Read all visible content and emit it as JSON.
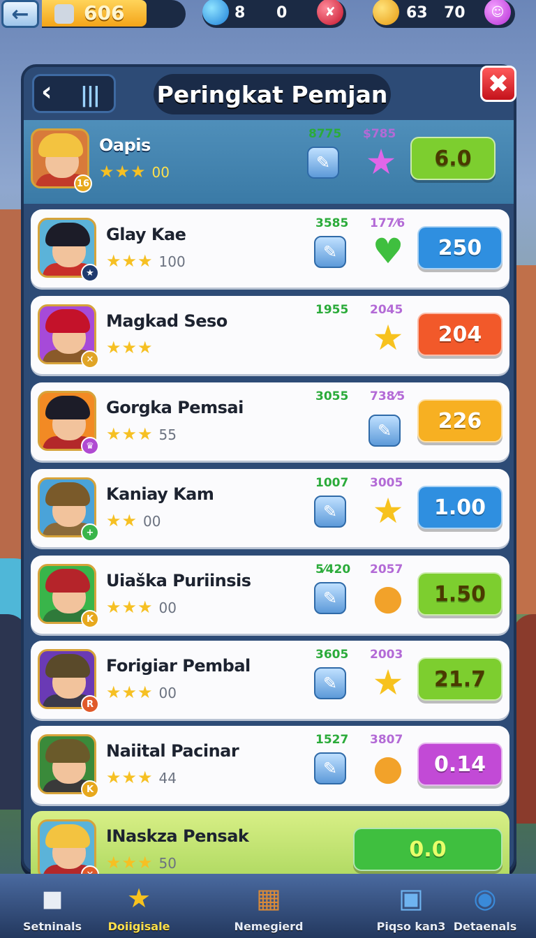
{
  "hud": {
    "coins": "606",
    "gems_a": "8",
    "gems_b": "0",
    "gold_a": "63",
    "gold_b": "70"
  },
  "panel": {
    "title": "Peringkat Pemjan"
  },
  "players": [
    {
      "name": "Oapis",
      "stars": "★★★",
      "points": "00",
      "stat1": "8775",
      "stat2": "$785",
      "score": "6.0",
      "icon1": "edit-icon",
      "icon2": "star-icon",
      "score_color": "#7dce2f",
      "score_text": "#4a3a00",
      "hair": "#f3c340",
      "body": "#c23a2a",
      "badge_color": "#e7a81d",
      "badge": "16",
      "avatar_bg": "#d87a3a"
    },
    {
      "name": "Glay Kae",
      "stars": "★★★",
      "points": "100",
      "stat1": "3585",
      "stat2": "177⁄6",
      "score": "250",
      "icon1": "edit-icon",
      "icon2": "heart-icon",
      "score_color": "#2f8fe0",
      "score_text": "#ffffff",
      "hair": "#1c1c28",
      "body": "#c8302a",
      "badge_color": "#1f3a6e",
      "badge": "★",
      "avatar_bg": "#5bb3d9"
    },
    {
      "name": "Magkad Seso",
      "stars": "★★★",
      "points": "",
      "stat1": "1955",
      "stat2": "2045",
      "score": "204",
      "icon1": "",
      "icon2": "star-icon",
      "score_color": "#f2592a",
      "score_text": "#ffffff",
      "hair": "#c4122a",
      "body": "#8a5a2a",
      "badge_color": "#e0a425",
      "badge": "✕",
      "avatar_bg": "#a64ad9"
    },
    {
      "name": "Gorgka Pemsai",
      "stars": "★★★",
      "points": "55",
      "stat1": "3055",
      "stat2": "738⁄5",
      "score": "226",
      "icon1": "",
      "icon2": "edit-icon",
      "score_color": "#f7b022",
      "score_text": "#ffffff",
      "hair": "#1c1c28",
      "body": "#b3282a",
      "badge_color": "#b04ad2",
      "badge": "♛",
      "avatar_bg": "#f28a24"
    },
    {
      "name": "Kaniay Kam",
      "stars": "★★",
      "points": "00",
      "stat1": "1007",
      "stat2": "3005",
      "score": "1.00",
      "icon1": "edit-icon",
      "icon2": "star-icon",
      "score_color": "#2f8fe0",
      "score_text": "#ffffff",
      "hair": "#7a5a2a",
      "body": "#8a6a3a",
      "badge_color": "#39b54a",
      "badge": "+",
      "avatar_bg": "#4aa3d9"
    },
    {
      "name": "Uiaška Puriinsis",
      "stars": "★★★",
      "points": "00",
      "stat1": "5⁄420",
      "stat2": "2057",
      "score": "1.50",
      "icon1": "edit-icon",
      "icon2": "cookie-icon",
      "score_color": "#7dce2f",
      "score_text": "#4a3a00",
      "hair": "#b5242a",
      "body": "#2f7a3a",
      "badge_color": "#e7a81d",
      "badge": "K",
      "avatar_bg": "#39b54a"
    },
    {
      "name": "Forigiar Pembal",
      "stars": "★★★",
      "points": "00",
      "stat1": "3605",
      "stat2": "2003",
      "score": "21.7",
      "icon1": "edit-icon",
      "icon2": "star-icon",
      "score_color": "#7dce2f",
      "score_text": "#4a3a00",
      "hair": "#5a4a2a",
      "body": "#3a3a4a",
      "badge_color": "#e05a2a",
      "badge": "R",
      "avatar_bg": "#6a3ab5"
    },
    {
      "name": "Naiital Pacinar",
      "stars": "★★★",
      "points": "44",
      "stat1": "1527",
      "stat2": "3807",
      "score": "0.14",
      "icon1": "edit-icon",
      "icon2": "cookie-icon",
      "score_color": "#c24ad6",
      "score_text": "#ffffff",
      "hair": "#6a5a2a",
      "body": "#3a3a3a",
      "badge_color": "#e7a81d",
      "badge": "K",
      "avatar_bg": "#3a8a3a"
    },
    {
      "name": "INaskza Pensak",
      "stars": "★★★",
      "points": "50",
      "stat1": "",
      "stat2": "",
      "score": "0.0",
      "icon1": "",
      "icon2": "",
      "score_color": "#3fbf3f",
      "score_text": "#e8ff6a",
      "hair": "#f3c340",
      "body": "#b3282a",
      "badge_color": "#e05a2a",
      "badge": "✕",
      "avatar_bg": "#5bb3d9"
    }
  ],
  "bottom_nav": [
    {
      "label": "Setninals",
      "icon": "cube-icon"
    },
    {
      "label": "Doiigisale",
      "icon": "star-icon"
    },
    {
      "label": "Nemegierd",
      "icon": "crate-icon"
    },
    {
      "label": "Piqso kan3",
      "icon": "box-icon"
    },
    {
      "label": "Detaenals",
      "icon": "barrel-icon"
    }
  ]
}
